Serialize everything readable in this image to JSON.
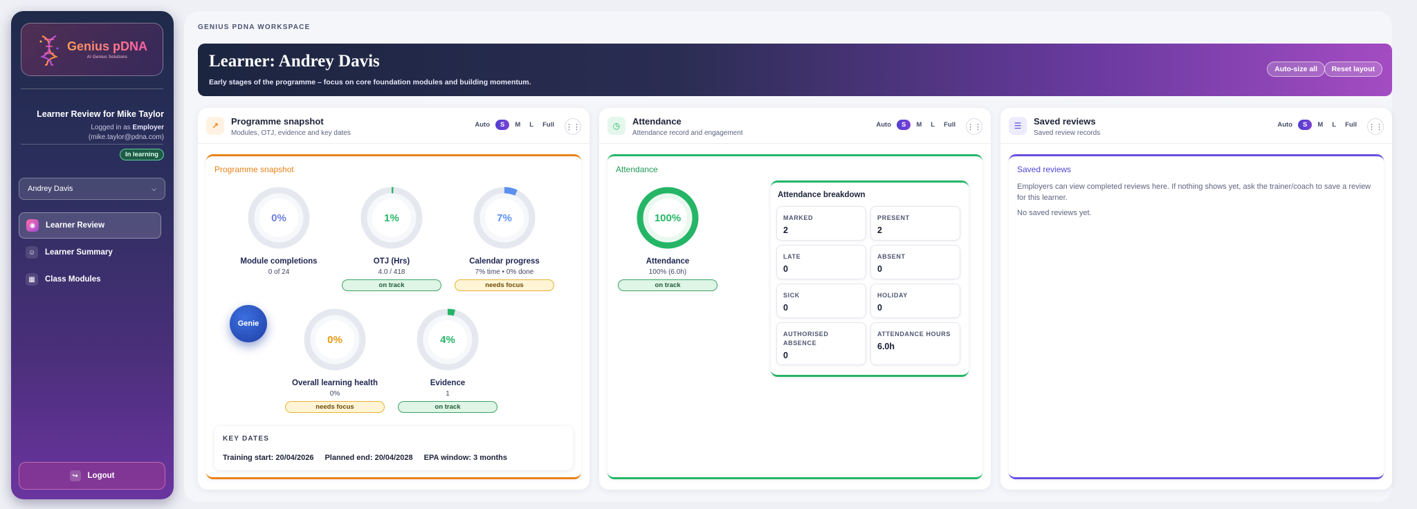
{
  "sidebar": {
    "logo_name": "Genius pDNA",
    "logo_sub": "AI Genius Solutions",
    "review_title": "Learner Review for Mike Taylor",
    "logged_in_prefix": "Logged in as",
    "logged_in_role": "Employer",
    "logged_in_email": "(mike.taylor@pdna.com)",
    "status_badge": "In learning",
    "learner_select": "Andrey Davis",
    "nav": [
      {
        "label": "Learner Review",
        "icon": "review-icon"
      },
      {
        "label": "Learner Summary",
        "icon": "person-icon"
      },
      {
        "label": "Class Modules",
        "icon": "calendar-icon"
      }
    ],
    "logout_label": "Logout"
  },
  "workspace": {
    "label": "GENIUS PDNA WORKSPACE",
    "hero_title": "Learner: Andrey Davis",
    "hero_sub": "Early stages of the programme – focus on core foundation modules and building momentum.",
    "btn_autosize": "Auto-size all",
    "btn_reset": "Reset layout"
  },
  "size_options": [
    "Auto",
    "S",
    "M",
    "L",
    "Full"
  ],
  "programme": {
    "title": "Programme snapshot",
    "subtitle": "Modules, OTJ, evidence and key dates",
    "inner_title": "Programme snapshot",
    "rings": [
      {
        "value": "0%",
        "fraction": 0.0,
        "label": "Module completions",
        "sub": "0 of 24",
        "pill": "",
        "pill_kind": "",
        "color": "#6b7fe0"
      },
      {
        "value": "1%",
        "fraction": 0.01,
        "label": "OTJ (Hrs)",
        "sub": "4.0 / 418",
        "pill": "on track",
        "pill_kind": "good",
        "color": "#25b566"
      },
      {
        "value": "7%",
        "fraction": 0.07,
        "label": "Calendar progress",
        "sub": "7% time • 0% done",
        "pill": "needs focus",
        "pill_kind": "warn",
        "color": "#5c8ff0"
      },
      {
        "value": "0%",
        "fraction": 0.0,
        "label": "Overall learning health",
        "sub": "0%",
        "pill": "needs focus",
        "pill_kind": "warn",
        "color": "#e89a18"
      },
      {
        "value": "4%",
        "fraction": 0.04,
        "label": "Evidence",
        "sub": "1",
        "pill": "on track",
        "pill_kind": "good",
        "color": "#25b566"
      }
    ],
    "genie_label": "Genie",
    "key_dates_title": "KEY DATES",
    "training_start": "Training start: 20/04/2026",
    "planned_end": "Planned end: 20/04/2028",
    "epa_window": "EPA window: 3 months"
  },
  "attendance": {
    "title": "Attendance",
    "subtitle": "Attendance record and engagement",
    "inner_title": "Attendance",
    "ring": {
      "value": "100%",
      "fraction": 1.0,
      "label": "Attendance",
      "sub": "100% (6.0h)",
      "pill": "on track",
      "color": "#25b566"
    },
    "breakdown_title": "Attendance breakdown",
    "stats": [
      {
        "key": "MARKED",
        "value": "2"
      },
      {
        "key": "PRESENT",
        "value": "2"
      },
      {
        "key": "LATE",
        "value": "0"
      },
      {
        "key": "ABSENT",
        "value": "0"
      },
      {
        "key": "SICK",
        "value": "0"
      },
      {
        "key": "HOLIDAY",
        "value": "0"
      },
      {
        "key": "AUTHORISED ABSENCE",
        "value": "0"
      },
      {
        "key": "ATTENDANCE HOURS",
        "value": "6.0h"
      }
    ]
  },
  "saved": {
    "title": "Saved reviews",
    "subtitle": "Saved review records",
    "inner_title": "Saved reviews",
    "body": "Employers can view completed reviews here. If nothing shows yet, ask the trainer/coach to save a review for this learner.",
    "empty": "No saved reviews yet."
  },
  "colors": {
    "programme_accent": "#e8821a",
    "attendance_accent": "#25b566",
    "saved_accent": "#6a4fe0"
  }
}
